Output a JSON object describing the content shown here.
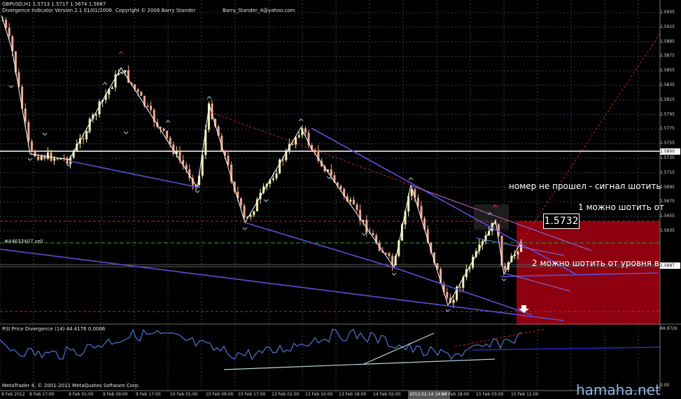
{
  "header": {
    "symbol_line": "GBPUSD,H1  1.5713 1.5717 1.5674 1.5687",
    "indicator_line": "Divergence Indicator Version 2.1  01/01/2006",
    "copyright": "Copyright © 2006 Barry Stander",
    "email": "Barry_Stander_4@yahoo.com"
  },
  "annotations": {
    "signal_text": "номер не прошел - сигнал шотить",
    "entry1_text": "1 можно шотить от",
    "entry2_text": "2 можно шотить от уровня в",
    "big_price": "1.5732",
    "order_label": "#44633407 sell"
  },
  "subwindow": {
    "title": "RSI Price Divergence (14) 44.4176 0.0006",
    "scale_top": "68.9726",
    "scale_bottom": "0.00"
  },
  "footer": {
    "metaquotes": "MetaTrader 4, © 2001-2011 MetaQuotes Software Corp."
  },
  "watermark": "hamaha.net",
  "price_axis": {
    "labels": [
      "1.5935",
      "1.5915",
      "1.5895",
      "1.5875",
      "1.5855",
      "1.5835",
      "1.5815",
      "1.5795",
      "1.5775",
      "1.5755",
      "1.5735",
      "1.5715",
      "1.5695",
      "1.5675",
      "1.5655",
      "1.5635"
    ],
    "hl_white": "1.5800",
    "hl_current": "1.5687"
  },
  "time_axis": [
    "8 Feb 2012",
    "8 Feb 17:00",
    "9 Feb 01:00",
    "9 Feb 09:00",
    "9 Feb 17:00",
    "10 Feb 01:00",
    "10 Feb 09:00",
    "10 Feb 17:00",
    "13 Feb 02:00",
    "13 Feb 10:00",
    "13 Feb 18:00",
    "14 Feb 02:00",
    "2012.02.14 14:00",
    "14 Feb 18:00",
    "15 Feb 03:00",
    "15 Feb 11:00"
  ],
  "colors": {
    "background": "#000000",
    "bull_candle": "#f3efb0",
    "bear_candle": "#f1a891",
    "zigzag": "#ffffff",
    "trendline": "#5d4fd6",
    "red_zone": "#8e0010",
    "rsi_line": "#4c77d6"
  }
}
